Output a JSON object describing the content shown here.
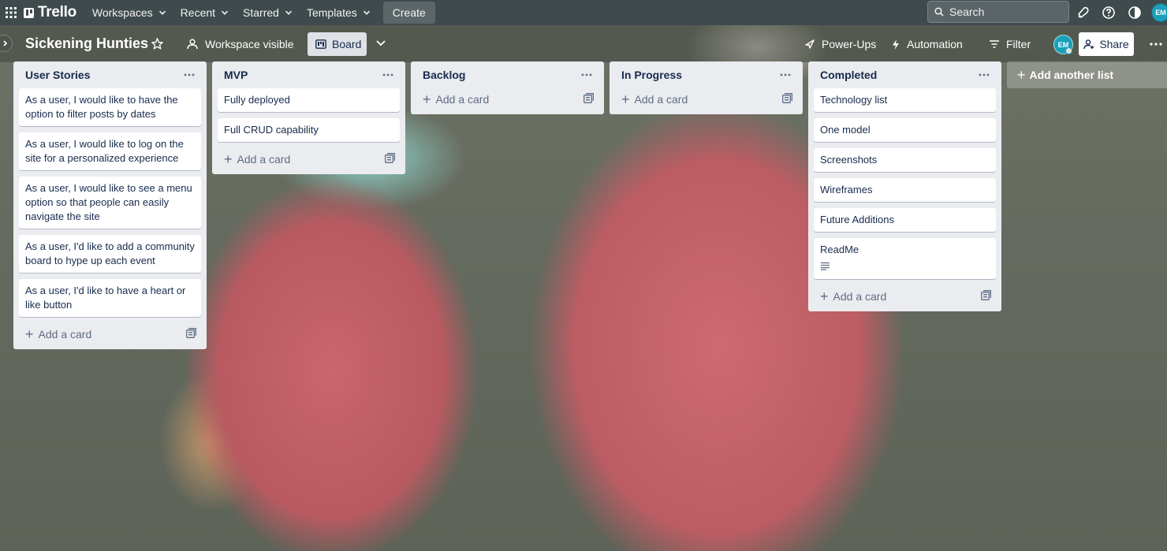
{
  "header": {
    "logo_text": "Trello",
    "nav": [
      {
        "label": "Workspaces"
      },
      {
        "label": "Recent"
      },
      {
        "label": "Starred"
      },
      {
        "label": "Templates"
      }
    ],
    "create_label": "Create",
    "search_placeholder": "Search",
    "avatar_initials": "EM",
    "icons": [
      "apps-icon",
      "notifications-icon",
      "help-icon",
      "theme-icon"
    ]
  },
  "board": {
    "title": "Sickening Hunties",
    "visibility_label": "Workspace visible",
    "view_label": "Board",
    "powerups_label": "Power-Ups",
    "automation_label": "Automation",
    "filter_label": "Filter",
    "member_initials": "EM",
    "share_label": "Share"
  },
  "lists": [
    {
      "title": "User Stories",
      "cards": [
        "As a user, I would like to have the option to filter posts by dates",
        "As a user, I would like to log on the site for a personalized experience",
        "As a user, I would like to see a menu option so that people can easily navigate the site",
        "As a user, I'd like to add a community board to hype up each event",
        "As a user, I'd like to have a heart or like button"
      ],
      "add_card_label": "Add a card"
    },
    {
      "title": "MVP",
      "cards": [
        "Fully deployed",
        "Full CRUD capability"
      ],
      "add_card_label": "Add a card"
    },
    {
      "title": "Backlog",
      "cards": [],
      "add_card_label": "Add a card"
    },
    {
      "title": "In Progress",
      "cards": [],
      "add_card_label": "Add a card"
    },
    {
      "title": "Completed",
      "cards": [
        "Technology list",
        "One model",
        "Screenshots",
        "Wireframes",
        "Future Additions",
        "ReadMe"
      ],
      "add_card_label": "Add a card"
    }
  ],
  "add_list_label": "Add another list",
  "colors": {
    "header_bg": "#3f4a4d",
    "list_bg": "#ebecf0",
    "avatar": "#1aa0b8",
    "text": "#172b4d"
  }
}
